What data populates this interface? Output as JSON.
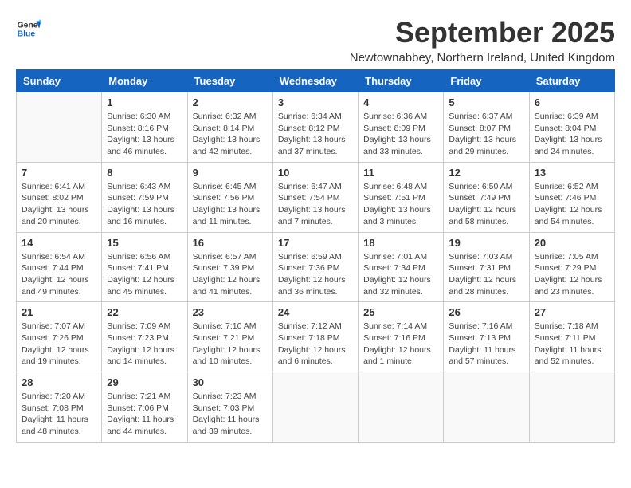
{
  "logo": {
    "line1": "General",
    "line2": "Blue"
  },
  "title": "September 2025",
  "subtitle": "Newtownabbey, Northern Ireland, United Kingdom",
  "days_of_week": [
    "Sunday",
    "Monday",
    "Tuesday",
    "Wednesday",
    "Thursday",
    "Friday",
    "Saturday"
  ],
  "weeks": [
    [
      {
        "day": "",
        "info": ""
      },
      {
        "day": "1",
        "info": "Sunrise: 6:30 AM\nSunset: 8:16 PM\nDaylight: 13 hours\nand 46 minutes."
      },
      {
        "day": "2",
        "info": "Sunrise: 6:32 AM\nSunset: 8:14 PM\nDaylight: 13 hours\nand 42 minutes."
      },
      {
        "day": "3",
        "info": "Sunrise: 6:34 AM\nSunset: 8:12 PM\nDaylight: 13 hours\nand 37 minutes."
      },
      {
        "day": "4",
        "info": "Sunrise: 6:36 AM\nSunset: 8:09 PM\nDaylight: 13 hours\nand 33 minutes."
      },
      {
        "day": "5",
        "info": "Sunrise: 6:37 AM\nSunset: 8:07 PM\nDaylight: 13 hours\nand 29 minutes."
      },
      {
        "day": "6",
        "info": "Sunrise: 6:39 AM\nSunset: 8:04 PM\nDaylight: 13 hours\nand 24 minutes."
      }
    ],
    [
      {
        "day": "7",
        "info": "Sunrise: 6:41 AM\nSunset: 8:02 PM\nDaylight: 13 hours\nand 20 minutes."
      },
      {
        "day": "8",
        "info": "Sunrise: 6:43 AM\nSunset: 7:59 PM\nDaylight: 13 hours\nand 16 minutes."
      },
      {
        "day": "9",
        "info": "Sunrise: 6:45 AM\nSunset: 7:56 PM\nDaylight: 13 hours\nand 11 minutes."
      },
      {
        "day": "10",
        "info": "Sunrise: 6:47 AM\nSunset: 7:54 PM\nDaylight: 13 hours\nand 7 minutes."
      },
      {
        "day": "11",
        "info": "Sunrise: 6:48 AM\nSunset: 7:51 PM\nDaylight: 13 hours\nand 3 minutes."
      },
      {
        "day": "12",
        "info": "Sunrise: 6:50 AM\nSunset: 7:49 PM\nDaylight: 12 hours\nand 58 minutes."
      },
      {
        "day": "13",
        "info": "Sunrise: 6:52 AM\nSunset: 7:46 PM\nDaylight: 12 hours\nand 54 minutes."
      }
    ],
    [
      {
        "day": "14",
        "info": "Sunrise: 6:54 AM\nSunset: 7:44 PM\nDaylight: 12 hours\nand 49 minutes."
      },
      {
        "day": "15",
        "info": "Sunrise: 6:56 AM\nSunset: 7:41 PM\nDaylight: 12 hours\nand 45 minutes."
      },
      {
        "day": "16",
        "info": "Sunrise: 6:57 AM\nSunset: 7:39 PM\nDaylight: 12 hours\nand 41 minutes."
      },
      {
        "day": "17",
        "info": "Sunrise: 6:59 AM\nSunset: 7:36 PM\nDaylight: 12 hours\nand 36 minutes."
      },
      {
        "day": "18",
        "info": "Sunrise: 7:01 AM\nSunset: 7:34 PM\nDaylight: 12 hours\nand 32 minutes."
      },
      {
        "day": "19",
        "info": "Sunrise: 7:03 AM\nSunset: 7:31 PM\nDaylight: 12 hours\nand 28 minutes."
      },
      {
        "day": "20",
        "info": "Sunrise: 7:05 AM\nSunset: 7:29 PM\nDaylight: 12 hours\nand 23 minutes."
      }
    ],
    [
      {
        "day": "21",
        "info": "Sunrise: 7:07 AM\nSunset: 7:26 PM\nDaylight: 12 hours\nand 19 minutes."
      },
      {
        "day": "22",
        "info": "Sunrise: 7:09 AM\nSunset: 7:23 PM\nDaylight: 12 hours\nand 14 minutes."
      },
      {
        "day": "23",
        "info": "Sunrise: 7:10 AM\nSunset: 7:21 PM\nDaylight: 12 hours\nand 10 minutes."
      },
      {
        "day": "24",
        "info": "Sunrise: 7:12 AM\nSunset: 7:18 PM\nDaylight: 12 hours\nand 6 minutes."
      },
      {
        "day": "25",
        "info": "Sunrise: 7:14 AM\nSunset: 7:16 PM\nDaylight: 12 hours\nand 1 minute."
      },
      {
        "day": "26",
        "info": "Sunrise: 7:16 AM\nSunset: 7:13 PM\nDaylight: 11 hours\nand 57 minutes."
      },
      {
        "day": "27",
        "info": "Sunrise: 7:18 AM\nSunset: 7:11 PM\nDaylight: 11 hours\nand 52 minutes."
      }
    ],
    [
      {
        "day": "28",
        "info": "Sunrise: 7:20 AM\nSunset: 7:08 PM\nDaylight: 11 hours\nand 48 minutes."
      },
      {
        "day": "29",
        "info": "Sunrise: 7:21 AM\nSunset: 7:06 PM\nDaylight: 11 hours\nand 44 minutes."
      },
      {
        "day": "30",
        "info": "Sunrise: 7:23 AM\nSunset: 7:03 PM\nDaylight: 11 hours\nand 39 minutes."
      },
      {
        "day": "",
        "info": ""
      },
      {
        "day": "",
        "info": ""
      },
      {
        "day": "",
        "info": ""
      },
      {
        "day": "",
        "info": ""
      }
    ]
  ]
}
